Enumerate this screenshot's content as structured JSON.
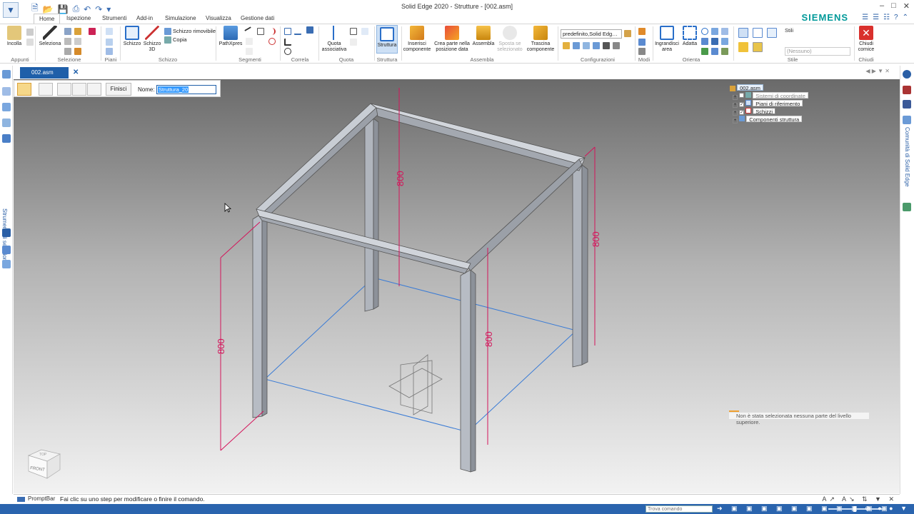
{
  "window": {
    "title": "Solid Edge 2020 - Strutture - [002.asm]",
    "brand": "SIEMENS",
    "controls": [
      "–",
      "□",
      "✕"
    ]
  },
  "ribbon_tabs": [
    "Home",
    "Ispezione",
    "Strumenti",
    "Add-in",
    "Simulazione",
    "Visualizza",
    "Gestione dati"
  ],
  "active_tab": "Home",
  "ribbon": {
    "buttons": {
      "incolla": "Incolla",
      "seleziona": "Seleziona",
      "schizzo": "Schizzo",
      "schizzo3d": "Schizzo 3D",
      "schizzo_rimovibile": "Schizzo rimovibile",
      "copia": "Copia",
      "pathxpres": "PathXpres",
      "quota_associativa": "Quota associativa",
      "struttura": "Struttura",
      "inserisci_componente": "Inserisci componente",
      "crea_parte": "Crea parte nella posizione data",
      "assembla": "Assembla",
      "sposta_selezionato": "Sposta se selezionato",
      "trascina_componente": "Trascina componente",
      "ingrandisci_area": "Ingrandisci area",
      "adatta": "Adatta",
      "chiudi_cornice": "Chiudi cornice"
    },
    "groups": {
      "appunti": "Appunti",
      "selezione": "Selezione",
      "piani": "Piani",
      "schizzo": "Schizzo",
      "segmenti": "Segmenti",
      "correla": "Correla",
      "quota": "Quota",
      "struttura": "Struttura",
      "assembla": "Assembla",
      "configurazioni": "Configurazioni",
      "modi": "Modi",
      "orienta": "Orienta",
      "stile": "Stile",
      "chiudi": "Chiudi"
    },
    "config_value": "predefinito,Solid Edg…",
    "stili_label": "Stili",
    "style_value": "(Nessuno)"
  },
  "document_tab": "002.asm",
  "left_panel_label": "Strumenti di selezione",
  "right_panel_label": "Comunità di Solid Edge",
  "command_bar": {
    "finish_label": "Finisci",
    "name_label": "Nome:",
    "name_value": "Struttura_20"
  },
  "pathfinder": {
    "root": "002.asm",
    "items": [
      {
        "label": "Sistemi di coordinate",
        "checked": false
      },
      {
        "label": "Piani di riferimento",
        "checked": true
      },
      {
        "label": "Schizzi",
        "checked": true
      },
      {
        "label": "Componenti struttura",
        "checked": false
      }
    ]
  },
  "viewport": {
    "message": "Non è stata selezionata nessuna parte del livello superiore.",
    "dimension_label": "800",
    "view_cube": {
      "top": "TOP",
      "front": "FRONT"
    }
  },
  "prompt": {
    "label": "PromptBar",
    "text": "Fai clic su uno step per modificare o finire il comando."
  },
  "status": {
    "search_placeholder": "Trova comando"
  },
  "colors": {
    "accent": "#1f5fa9",
    "status_bar": "#2a64ae",
    "brand": "#009999",
    "dimension": "#d4145a",
    "sketch_line": "#3a7bd5"
  }
}
